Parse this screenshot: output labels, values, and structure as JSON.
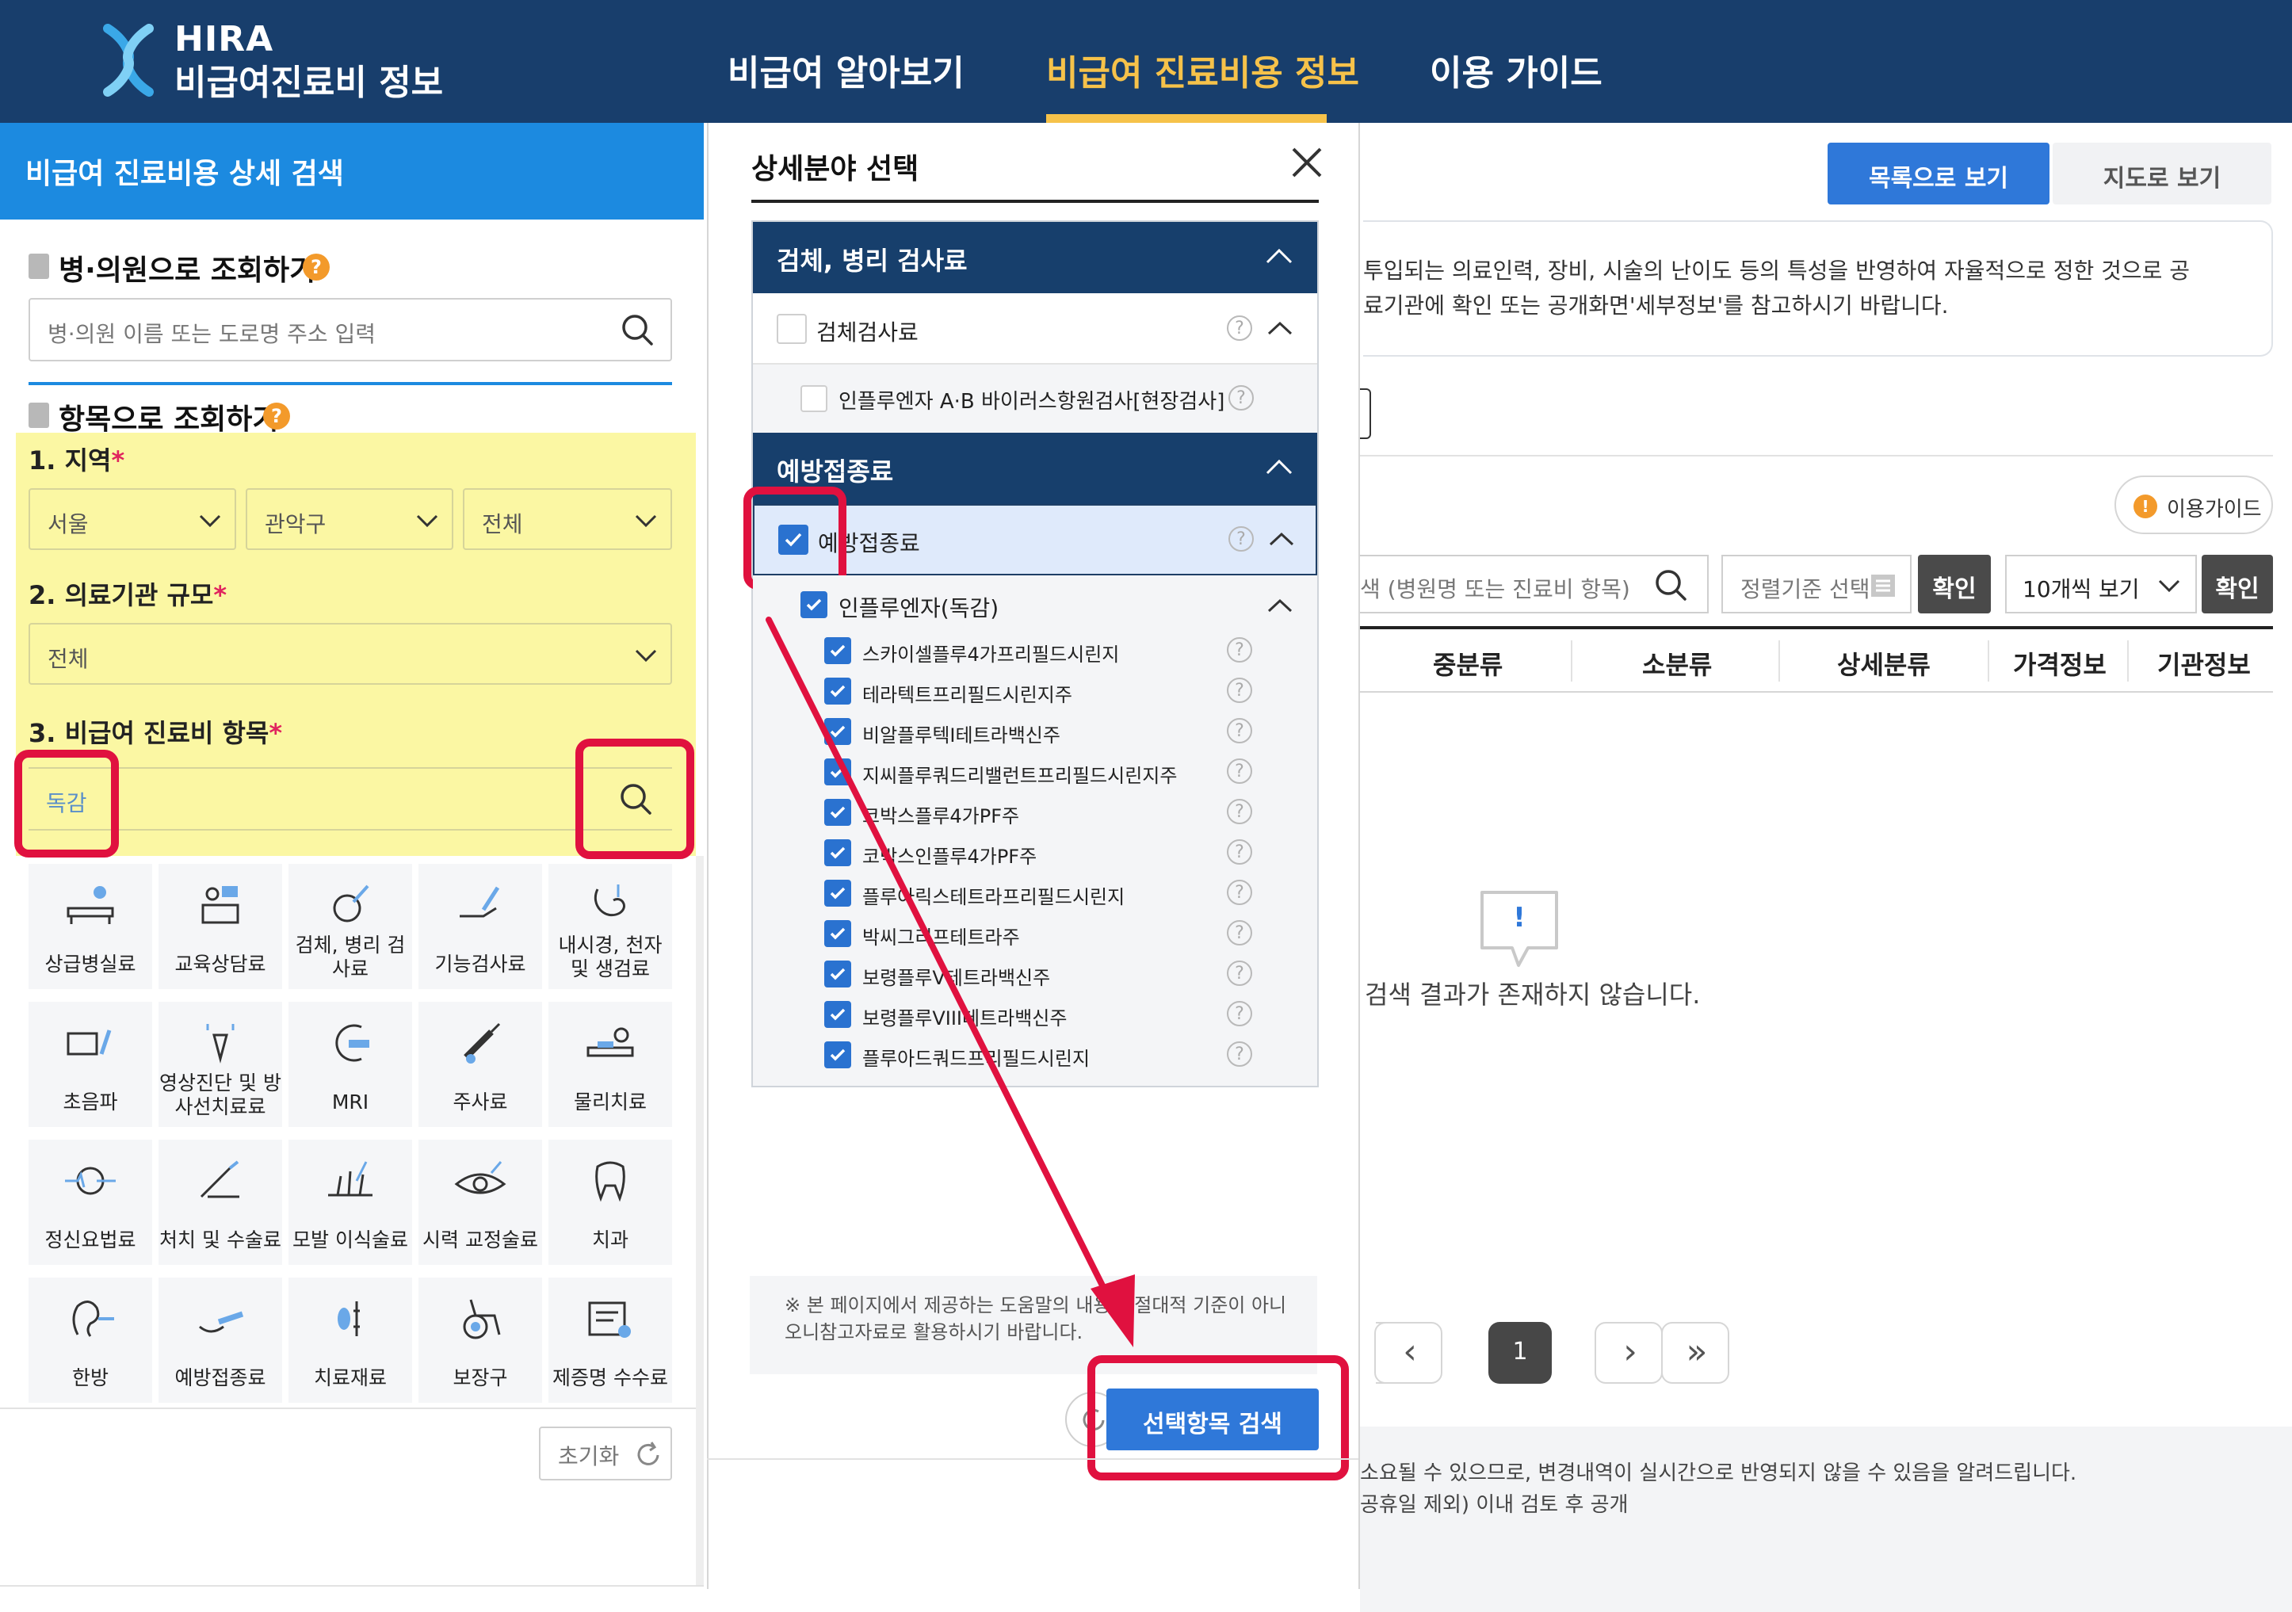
{
  "header": {
    "logo_line1": "HIRA",
    "logo_line2": "비급여진료비 정보",
    "nav": [
      "비급여 알아보기",
      "비급여 진료비용 정보",
      "이용 가이드"
    ],
    "active_color": "#f6c24a",
    "bg_color": "#183e6c"
  },
  "left": {
    "title": "비급여 진료비용 상세 검색",
    "hospital_section": {
      "title": "병·의원으로 조회하기",
      "placeholder": "병·의원 이름 또는 도로명 주소 입력"
    },
    "item_section": {
      "title": "항목으로 조회하기",
      "region_label": "1. 지역",
      "region_values": [
        "서울",
        "관악구",
        "전체"
      ],
      "scale_label": "2. 의료기관 규모",
      "scale_value": "전체",
      "item_label": "3. 비급여 진료비 항목",
      "item_value": "독감",
      "required_mark": "*"
    },
    "categories": [
      {
        "label": "상급병실료",
        "icon": "hospital-bed-icon"
      },
      {
        "label": "교육상담료",
        "icon": "consultation-icon"
      },
      {
        "label": "검체, 병리 검사료",
        "icon": "specimen-test-icon"
      },
      {
        "label": "기능검사료",
        "icon": "function-test-icon"
      },
      {
        "label": "내시경, 천자 및 생검료",
        "icon": "endoscope-icon"
      },
      {
        "label": "초음파",
        "icon": "ultrasound-icon"
      },
      {
        "label": "영상진단 및 방사선치료료",
        "icon": "radiology-icon"
      },
      {
        "label": "MRI",
        "icon": "mri-icon"
      },
      {
        "label": "주사료",
        "icon": "syringe-icon"
      },
      {
        "label": "물리치료",
        "icon": "physical-therapy-icon"
      },
      {
        "label": "정신요법료",
        "icon": "psychotherapy-icon"
      },
      {
        "label": "처치 및 수술료",
        "icon": "surgery-icon"
      },
      {
        "label": "모발 이식술료",
        "icon": "hair-transplant-icon"
      },
      {
        "label": "시력 교정술료",
        "icon": "eye-correction-icon"
      },
      {
        "label": "치과",
        "icon": "tooth-icon"
      },
      {
        "label": "한방",
        "icon": "oriental-medicine-icon"
      },
      {
        "label": "예방접종료",
        "icon": "vaccination-icon"
      },
      {
        "label": "치료재료",
        "icon": "treatment-material-icon"
      },
      {
        "label": "보장구",
        "icon": "wheelchair-icon"
      },
      {
        "label": "제증명 수수료",
        "icon": "certificate-icon"
      }
    ],
    "reset_label": "초기화"
  },
  "modal": {
    "title": "상세분야 선택",
    "group1": {
      "title": "검체, 병리 검사료",
      "sub": "검체검사료",
      "sub_item": "인플루엔자 A·B 바이러스항원검사[현장검사]"
    },
    "group2": {
      "title": "예방접종료",
      "sub": "예방접종료",
      "parent": "인플루엔자(독감)",
      "children": [
        "스카이셀플루4가프리필드시린지",
        "테라텍트프리필드시린지주",
        "비알플루텍I테트라백신주",
        "지씨플루쿼드리밸런트프리필드시린지주",
        "코박스플루4가PF주",
        "코박스인플루4가PF주",
        "플루아릭스테트라프리필드시린지",
        "박씨그리프테트라주",
        "보령플루V테트라백신주",
        "보령플루VIII테트라백신주",
        "플루아드쿼드프리필드시린지"
      ]
    },
    "help_mark": "?",
    "notice": "※ 본 페이지에서 제공하는 도움말의 내용은 절대적 기준이 아니 오니참고자료로 활용하시기 바랍니다.",
    "search_button": "선택항목 검색"
  },
  "right": {
    "view_list": "목록으로 보기",
    "view_map": "지도로 보기",
    "info_line1": "투입되는 의료인력, 장비, 시술의 난이도 등의 특성을 반영하여 자율적으로 정한 것으로 공",
    "info_line2": "료기관에 확인 또는 공개화면'세부정보'를 참고하시기 바랍니다.",
    "guide_button": "이용가이드",
    "guide_mark": "!",
    "search_placeholder": "색 (병원명 또는 진료비 항목)",
    "sort_placeholder": "정렬기준 선택",
    "confirm": "확인",
    "page_size": "10개씩 보기",
    "table_headers": [
      "중분류",
      "소분류",
      "상세분류",
      "가격정보",
      "기관정보"
    ],
    "empty_mark": "!",
    "empty_message": "검색 결과가 존재하지 않습니다.",
    "pagination": {
      "current": "1",
      "prev": "‹",
      "next": "›",
      "last": "»"
    },
    "footer_line1": "소요될 수 있으므로, 변경내역이 실시간으로 반영되지 않을 수 있음을 알려드립니다.",
    "footer_line2": "공휴일 제외) 이내 검토 후 공개"
  },
  "annotations": {
    "highlight_color": "#e0113f",
    "arrow_color": "#e0113f"
  }
}
